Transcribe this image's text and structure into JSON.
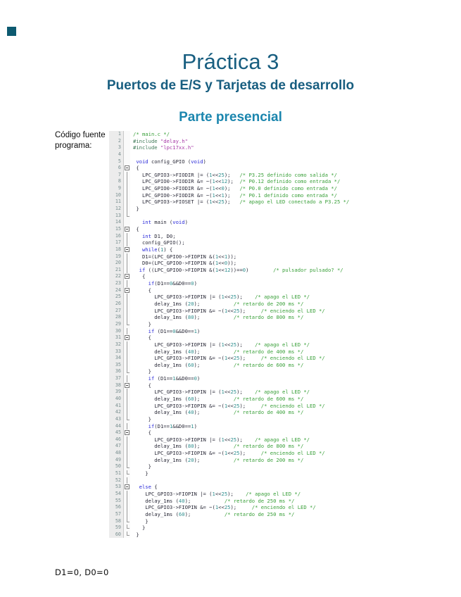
{
  "page": {
    "title": "Práctica 3",
    "subtitle": "Puertos de E/S y Tarjetas de desarrollo",
    "section_heading": "Parte presencial",
    "side_label": "Código fuente programa:",
    "footer_note": "D1=0, D0=0",
    "corner_square_color": "#0d5a70"
  },
  "colors": {
    "heading": "#185e80",
    "section_heading": "#1b86ae",
    "comment": "#3aa03a",
    "string": "#a637a6",
    "keyword": "#2b2bd9",
    "number": "#2f8f8f"
  },
  "code_listing": {
    "lines": [
      {
        "n": 1,
        "fold": "",
        "text": "/* main.c */"
      },
      {
        "n": 2,
        "fold": "",
        "text": "#include \"delay.h\""
      },
      {
        "n": 3,
        "fold": "",
        "text": "#include \"lpc17xx.h\""
      },
      {
        "n": 4,
        "fold": "",
        "text": ""
      },
      {
        "n": 5,
        "fold": "",
        "text": " void config_GPIO (void)"
      },
      {
        "n": 6,
        "fold": "open",
        "text": " {"
      },
      {
        "n": 7,
        "fold": "line",
        "text": "   LPC_GPIO3->FIODIR |= (1<<25);   /* P3.25 definido como salida */"
      },
      {
        "n": 8,
        "fold": "line",
        "text": "   LPC_GPIO0->FIODIR &= ~(1<<12);  /* P0.12 definido como entrada */"
      },
      {
        "n": 9,
        "fold": "line",
        "text": "   LPC_GPIO0->FIODIR &= ~(1<<0);   /* P0.0 definido como entrada */"
      },
      {
        "n": 10,
        "fold": "line",
        "text": "   LPC_GPIO0->FIODIR &= ~(1<<1);   /* P0.1 definido como entrada */"
      },
      {
        "n": 11,
        "fold": "line",
        "text": "   LPC_GPIO3->FIOSET |= (1<<25);   /* apago el LED conectado a P3.25 */"
      },
      {
        "n": 12,
        "fold": "line",
        "text": " }"
      },
      {
        "n": 13,
        "fold": "end",
        "text": ""
      },
      {
        "n": 14,
        "fold": "",
        "text": "   int main (void)"
      },
      {
        "n": 15,
        "fold": "open",
        "text": " {"
      },
      {
        "n": 16,
        "fold": "line",
        "text": "   int D1, D0;"
      },
      {
        "n": 17,
        "fold": "line",
        "text": "   config_GPIO();"
      },
      {
        "n": 18,
        "fold": "open",
        "text": "   while(1) {"
      },
      {
        "n": 19,
        "fold": "line",
        "text": "   D1=(LPC_GPIO0->FIOPIN &(1<<1));"
      },
      {
        "n": 20,
        "fold": "line",
        "text": "   D0=(LPC_GPIO0->FIOPIN &(1<<0));"
      },
      {
        "n": 21,
        "fold": "line",
        "text": "  if ((LPC_GPIO0->FIOPIN &(1<<12))==0)        /* pulsador pulsado? */"
      },
      {
        "n": 22,
        "fold": "open",
        "text": "   {"
      },
      {
        "n": 23,
        "fold": "line",
        "text": "     if(D1==0&&D0==0)"
      },
      {
        "n": 24,
        "fold": "open",
        "text": "     {"
      },
      {
        "n": 25,
        "fold": "line",
        "text": "       LPC_GPIO3->FIOPIN |= (1<<25);    /* apago el LED */"
      },
      {
        "n": 26,
        "fold": "line",
        "text": "       delay_1ms (20);           /* retardo de 200 ms */"
      },
      {
        "n": 27,
        "fold": "line",
        "text": "       LPC_GPIO3->FIOPIN &= ~(1<<25);     /* enciendo el LED */"
      },
      {
        "n": 28,
        "fold": "line",
        "text": "       delay_1ms (80);           /* retardo de 800 ms */"
      },
      {
        "n": 29,
        "fold": "end",
        "text": "     }"
      },
      {
        "n": 30,
        "fold": "line",
        "text": "     if (D1==0&&D0==1)"
      },
      {
        "n": 31,
        "fold": "open",
        "text": "     {"
      },
      {
        "n": 32,
        "fold": "line",
        "text": "       LPC_GPIO3->FIOPIN |= (1<<25);    /* apago el LED */"
      },
      {
        "n": 33,
        "fold": "line",
        "text": "       delay_1ms (40);           /* retardo de 400 ms */"
      },
      {
        "n": 34,
        "fold": "line",
        "text": "       LPC_GPIO3->FIOPIN &= ~(1<<25);     /* enciendo el LED */"
      },
      {
        "n": 35,
        "fold": "line",
        "text": "       delay_1ms (60);           /* retardo de 600 ms */"
      },
      {
        "n": 36,
        "fold": "end",
        "text": "     }"
      },
      {
        "n": 37,
        "fold": "line",
        "text": "     if (D1==1&&D0==0)"
      },
      {
        "n": 38,
        "fold": "open",
        "text": "     {"
      },
      {
        "n": 39,
        "fold": "line",
        "text": "       LPC_GPIO3->FIOPIN |= (1<<25);    /* apago el LED */"
      },
      {
        "n": 40,
        "fold": "line",
        "text": "       delay_1ms (60);           /* retardo de 600 ms */"
      },
      {
        "n": 41,
        "fold": "line",
        "text": "       LPC_GPIO3->FIOPIN &= ~(1<<25);     /* enciendo el LED */"
      },
      {
        "n": 42,
        "fold": "line",
        "text": "       delay_1ms (40);           /* retardo de 400 ms */"
      },
      {
        "n": 43,
        "fold": "end",
        "text": "     }"
      },
      {
        "n": 44,
        "fold": "line",
        "text": "     if(D1==1&&D0==1)"
      },
      {
        "n": 45,
        "fold": "open",
        "text": "     {"
      },
      {
        "n": 46,
        "fold": "line",
        "text": "       LPC_GPIO3->FIOPIN |= (1<<25);    /* apago el LED */"
      },
      {
        "n": 47,
        "fold": "line",
        "text": "       delay_1ms (80);           /* retardo de 800 ms */"
      },
      {
        "n": 48,
        "fold": "line",
        "text": "       LPC_GPIO3->FIOPIN &= ~(1<<25);     /* enciendo el LED */"
      },
      {
        "n": 49,
        "fold": "line",
        "text": "       delay_1ms (20);           /* retardo de 200 ms */"
      },
      {
        "n": 50,
        "fold": "end",
        "text": "     }"
      },
      {
        "n": 51,
        "fold": "end",
        "text": "    }"
      },
      {
        "n": 52,
        "fold": "line",
        "text": ""
      },
      {
        "n": 53,
        "fold": "open",
        "text": "  else {"
      },
      {
        "n": 54,
        "fold": "line",
        "text": "    LPC_GPIO3->FIOPIN |= (1<<25);    /* apago el LED */"
      },
      {
        "n": 55,
        "fold": "line",
        "text": "    delay_1ms (40);           /* retardo de 250 ms */"
      },
      {
        "n": 56,
        "fold": "line",
        "text": "    LPC_GPIO3->FIOPIN &= ~(1<<25);     /* enciendo el LED */"
      },
      {
        "n": 57,
        "fold": "line",
        "text": "    delay_1ms (60);           /* retardo de 250 ms */"
      },
      {
        "n": 58,
        "fold": "end",
        "text": "    }"
      },
      {
        "n": 59,
        "fold": "end",
        "text": "   }"
      },
      {
        "n": 60,
        "fold": "end",
        "text": " }"
      }
    ]
  }
}
